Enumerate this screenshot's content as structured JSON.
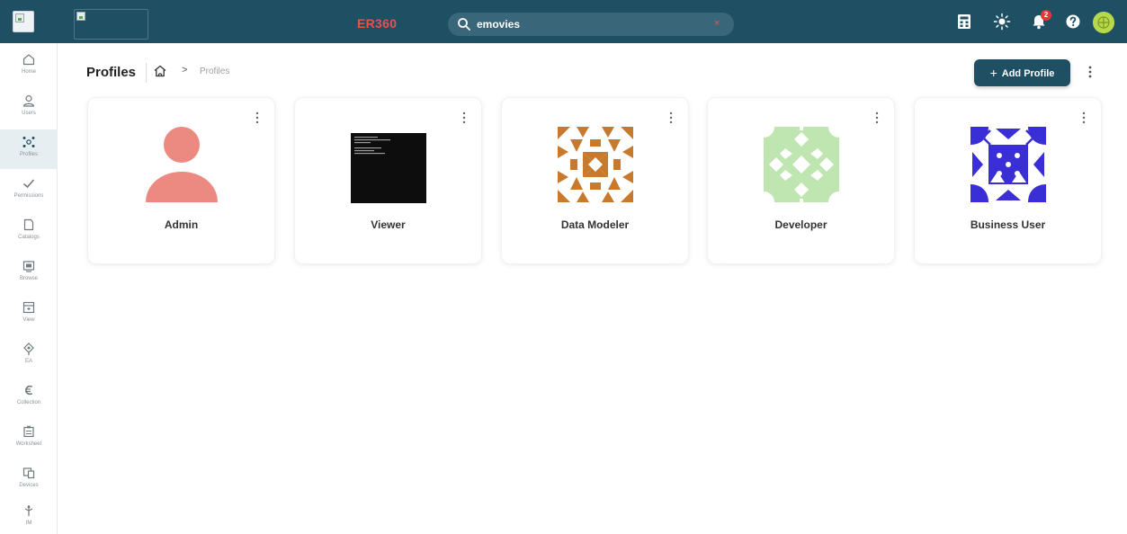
{
  "header": {
    "app_title": "ER360",
    "search_value": "emovies",
    "search_clear": "×",
    "notification_count": "2",
    "colors": {
      "bar": "#1f4f63",
      "title": "#e8524a"
    }
  },
  "sidebar": {
    "items": [
      {
        "label": "Home",
        "icon": "home-icon"
      },
      {
        "label": "Users",
        "icon": "user-icon"
      },
      {
        "label": "Profiles",
        "icon": "profiles-icon",
        "active": true
      },
      {
        "label": "Permissions",
        "icon": "check-icon"
      },
      {
        "label": "Catalogs",
        "icon": "catalog-icon"
      },
      {
        "label": "Browse",
        "icon": "browse-icon"
      },
      {
        "label": "View",
        "icon": "view-icon"
      },
      {
        "label": "EA",
        "icon": "ea-icon"
      },
      {
        "label": "Collection",
        "icon": "collection-icon"
      },
      {
        "label": "Worksheet",
        "icon": "worksheet-icon"
      },
      {
        "label": "Devices",
        "icon": "devices-icon"
      },
      {
        "label": "IM",
        "icon": "im-icon"
      }
    ]
  },
  "main": {
    "title": "Profiles",
    "breadcrumb_current": "Profiles",
    "breadcrumb_chevron": ">",
    "add_button_icon": "+",
    "add_button_label": "Add Profile"
  },
  "profiles": [
    {
      "name": "Admin",
      "avatar": "person-avatar"
    },
    {
      "name": "Viewer",
      "avatar": "terminal-screenshot"
    },
    {
      "name": "Data Modeler",
      "avatar": "orange-geometric-pattern"
    },
    {
      "name": "Developer",
      "avatar": "green-geometric-pattern"
    },
    {
      "name": "Business User",
      "avatar": "blue-geometric-pattern"
    }
  ]
}
